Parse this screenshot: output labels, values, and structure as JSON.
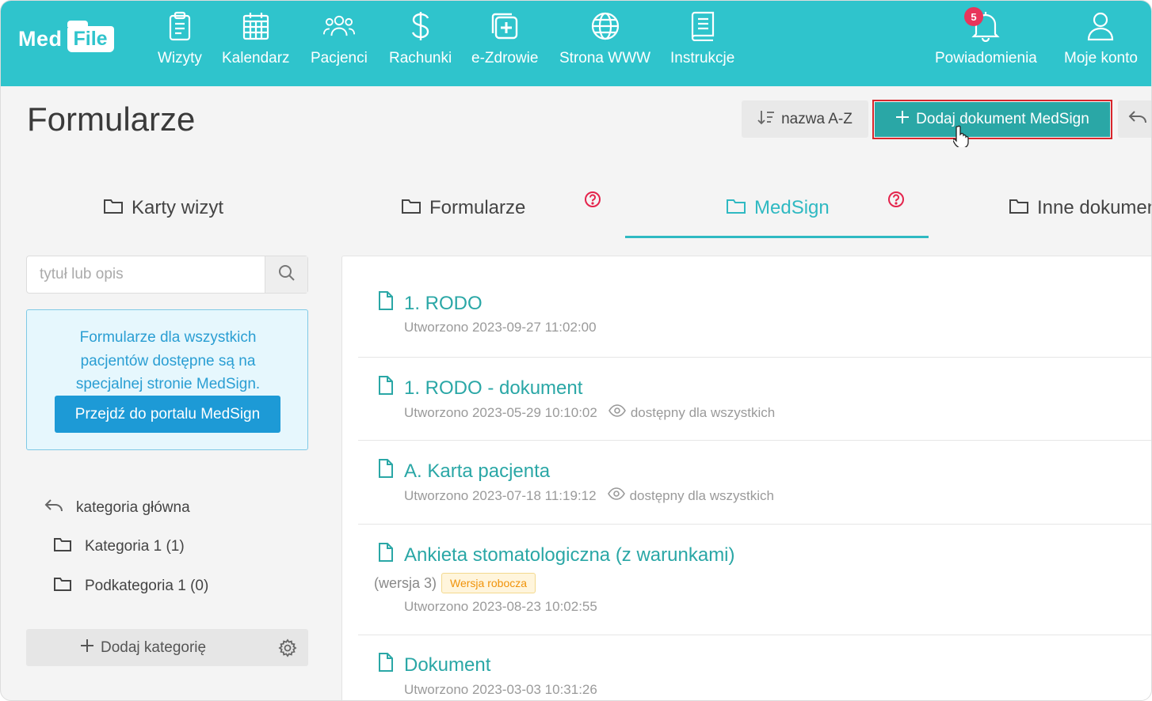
{
  "app": {
    "logo_med": "Med",
    "logo_file": "File"
  },
  "nav": {
    "items": [
      {
        "label": "Wizyty",
        "icon": "clipboard-icon"
      },
      {
        "label": "Kalendarz",
        "icon": "calendar-icon"
      },
      {
        "label": "Pacjenci",
        "icon": "patients-icon"
      },
      {
        "label": "Rachunki",
        "icon": "dollar-icon"
      },
      {
        "label": "e-Zdrowie",
        "icon": "medical-plus-icon"
      },
      {
        "label": "Strona WWW",
        "icon": "globe-icon"
      },
      {
        "label": "Instrukcje",
        "icon": "book-icon"
      }
    ],
    "notifications_label": "Powiadomienia",
    "notifications_count": "5",
    "account_label": "Moje konto"
  },
  "header": {
    "title": "Formularze",
    "sort_label": "nazwa A-Z",
    "add_label": "Dodaj dokument MedSign"
  },
  "tabs": [
    {
      "label": "Karty wizyt"
    },
    {
      "label": "Formularze"
    },
    {
      "label": "MedSign"
    },
    {
      "label": "Inne dokumenty"
    }
  ],
  "sidebar": {
    "search_placeholder": "tytuł lub opis",
    "info_text": "Formularze dla wszystkich pacjentów dostępne są na specjalnej stronie MedSign.",
    "portal_button": "Przejdź do portalu MedSign",
    "categories": [
      {
        "label": "kategoria główna"
      },
      {
        "label": "Kategoria 1 (1)"
      },
      {
        "label": "Podkategoria 1 (0)"
      }
    ],
    "add_category_label": "Dodaj kategorię"
  },
  "documents": [
    {
      "title": "1. RODO",
      "created": "Utworzono 2023-09-27 11:02:00",
      "visibility": ""
    },
    {
      "title": "1. RODO - dokument",
      "created": "Utworzono 2023-05-29 10:10:02",
      "visibility": "dostępny dla wszystkich"
    },
    {
      "title": "A. Karta pacjenta",
      "created": "Utworzono 2023-07-18 11:19:12",
      "visibility": "dostępny dla wszystkich"
    },
    {
      "title": "Ankieta stomatologiczna (z warunkami)",
      "version": "(wersja 3)",
      "badge": "Wersja robocza",
      "created": "Utworzono 2023-08-23 10:02:55",
      "visibility": ""
    },
    {
      "title": "Dokument",
      "created": "Utworzono 2023-03-03 10:31:26",
      "visibility": ""
    }
  ],
  "colors": {
    "brand": "#2fc4cc",
    "accent": "#2aa7a6",
    "highlight_border": "#d9262c",
    "badge": "#e8355b"
  }
}
